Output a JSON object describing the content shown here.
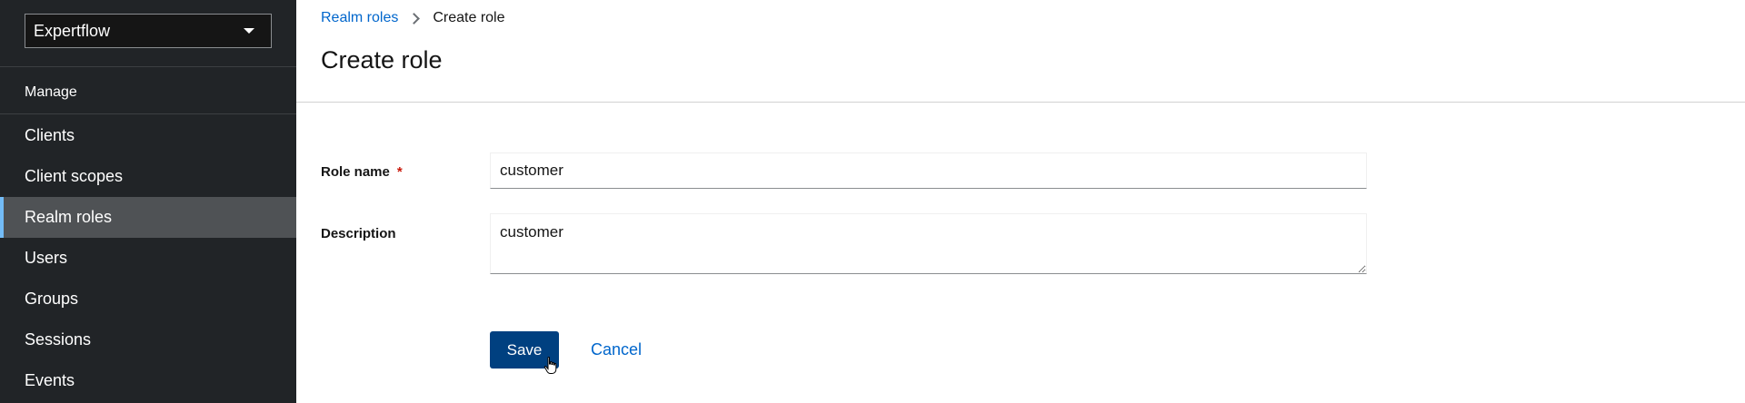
{
  "sidebar": {
    "realm_selector": {
      "value": "Expertflow"
    },
    "section_title": "Manage",
    "items": [
      {
        "label": "Clients"
      },
      {
        "label": "Client scopes"
      },
      {
        "label": "Realm roles",
        "active": true
      },
      {
        "label": "Users"
      },
      {
        "label": "Groups"
      },
      {
        "label": "Sessions"
      },
      {
        "label": "Events"
      }
    ]
  },
  "breadcrumb": {
    "parent": "Realm roles",
    "current": "Create role"
  },
  "page": {
    "title": "Create role"
  },
  "form": {
    "role_name": {
      "label": "Role name",
      "required_marker": "*",
      "value": "customer"
    },
    "description": {
      "label": "Description",
      "value": "customer"
    }
  },
  "actions": {
    "save_label": "Save",
    "cancel_label": "Cancel"
  },
  "colors": {
    "sidebar_bg": "#212427",
    "active_item_bg": "#4f5255",
    "active_accent": "#73bcf7",
    "primary_button": "#004080",
    "link": "#0066cc",
    "required": "#c9190b"
  }
}
